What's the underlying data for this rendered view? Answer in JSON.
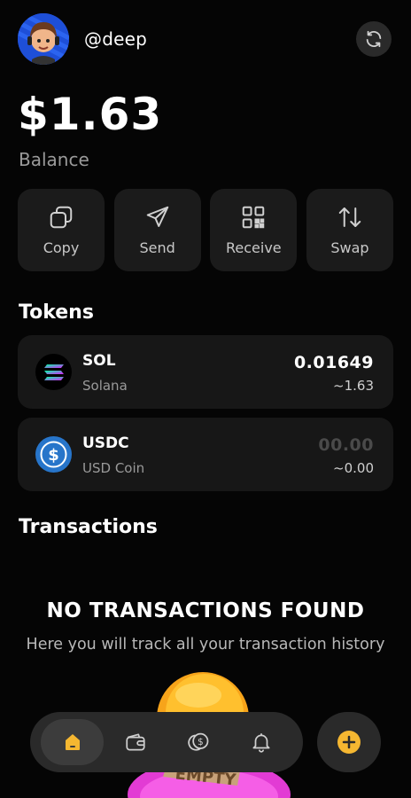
{
  "profile": {
    "username": "@deep",
    "avatar_icon": "avatar-icon",
    "refresh_icon": "refresh-icon"
  },
  "wallet": {
    "balance": "$1.63",
    "balance_label": "Balance"
  },
  "actions": [
    {
      "label": "Copy",
      "icon": "copy-icon"
    },
    {
      "label": "Send",
      "icon": "send-icon"
    },
    {
      "label": "Receive",
      "icon": "qr-code-icon"
    },
    {
      "label": "Swap",
      "icon": "swap-icon"
    }
  ],
  "tokens_section": {
    "title": "Tokens",
    "items": [
      {
        "symbol": "SOL",
        "name": "Solana",
        "amount": "0.01649",
        "value": "~1.63",
        "icon": "solana-icon"
      },
      {
        "symbol": "USDC",
        "name": "USD Coin",
        "amount": "00.00",
        "value": "~0.00",
        "icon": "usdc-icon"
      }
    ]
  },
  "transactions_section": {
    "title": "Transactions",
    "empty_title": "NO TRANSACTIONS FOUND",
    "empty_subtitle": "Here you will track all your transaction history",
    "illustration_text": "EMPTY"
  },
  "nav": {
    "items": [
      {
        "icon": "home-icon",
        "active": true
      },
      {
        "icon": "wallet-icon",
        "active": false
      },
      {
        "icon": "coins-icon",
        "active": false
      },
      {
        "icon": "bell-icon",
        "active": false
      }
    ],
    "fab_icon": "plus-circle-icon"
  },
  "colors": {
    "accent": "#f5b731",
    "background": "#050505",
    "card": "#171717",
    "usdc_blue": "#2775ca"
  }
}
